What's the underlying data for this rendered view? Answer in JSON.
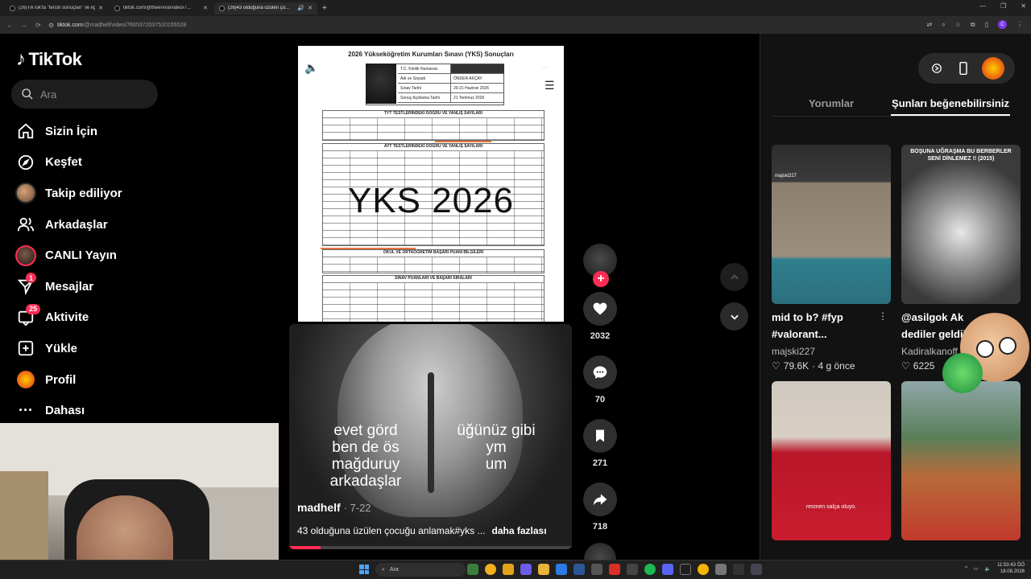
{
  "browser": {
    "tabs": [
      {
        "title": "(26)TikTok'ta \"tercih sonuçları\" ile ilgili...",
        "active": false
      },
      {
        "title": "tiktok.com/@theervva/video/7...",
        "active": false
      },
      {
        "title": "(26)43 olduğuna üzülen ço...",
        "active": true
      }
    ],
    "url_host": "tiktok.com",
    "url_path": "/@madhelf/video/7665372037510155528",
    "profile_initial": "C"
  },
  "sidebar": {
    "logo": "TikTok",
    "search_placeholder": "Ara",
    "items": [
      {
        "label": "Sizin İçin",
        "icon": "home-icon"
      },
      {
        "label": "Keşfet",
        "icon": "compass-icon"
      },
      {
        "label": "Takip ediliyor",
        "icon": "avatar"
      },
      {
        "label": "Arkadaşlar",
        "icon": "friends-icon"
      },
      {
        "label": "CANLI Yayın",
        "icon": "live-avatar"
      },
      {
        "label": "Mesajlar",
        "icon": "send-icon",
        "badge": "1"
      },
      {
        "label": "Aktivite",
        "icon": "inbox-icon",
        "badge": "25"
      },
      {
        "label": "Yükle",
        "icon": "plus-square-icon"
      },
      {
        "label": "Profil",
        "icon": "profile-avatar"
      },
      {
        "label": "Dahası",
        "icon": "more-icon"
      }
    ]
  },
  "video": {
    "doc_title": "2026 Yükseköğretim Kurumları Sınavı (YKS) Sonuçları",
    "id_rows": [
      {
        "k": "T.C. Kimlik Numarası",
        "v": ""
      },
      {
        "k": "Adı ve Soyadı",
        "v": "ÖNDER AKÇAY"
      },
      {
        "k": "Sınav Tarihi",
        "v": "20-21 Haziran 2026"
      },
      {
        "k": "Sonuç Açıklama Tarihi",
        "v": "21 Temmuz 2026"
      }
    ],
    "section_tyt": "TYT TESTLERİNDEKİ DOĞRU VE YANLIŞ SAYILARI",
    "section_ayt": "AYT TESTLERİNDEKİ DOĞRU VE YANLIŞ SAYILARI",
    "section_obp": "OKUL VE ORTAÖĞRETİM BAŞARI PUANI BİLGİLERİ",
    "section_puan": "SINAV PUANLARI VE BAŞARI SIRALARI",
    "overlay_title": "YKS 2026",
    "caption_left": "evet görd\nben de ös\nmağduruy\narkadaşlar",
    "caption_right": "üğünüz gibi\nym\num",
    "author": "madhelf",
    "date": "· 7-22",
    "description": "43 olduğuna üzülen çocuğu anlamak#yks ...",
    "more": "daha fazlası",
    "progress": 0.11
  },
  "actions": {
    "likes": "2032",
    "comments": "70",
    "saves": "271",
    "shares": "718"
  },
  "right_panel": {
    "tabs": [
      "Yorumlar",
      "Şunları beğenebilirsiniz"
    ],
    "active_tab": 1,
    "cards": [
      {
        "title": "mid to b? #fyp\n#valorant...",
        "author": "majski227",
        "likes": "79.6K",
        "age": "· 4 g önce",
        "thumb_tag": "majski227"
      },
      {
        "title": "@asilgok Ak\ndediler geldik",
        "author": "Kadiralkanoff",
        "likes": "6225",
        "age": "",
        "banner": "BOŞUNA UĞRAŞMA BU BERBERLER\nSENİ DİNLEMEZ !! (2015)"
      },
      {
        "title": "",
        "author": "",
        "likes": "",
        "age": "",
        "sub": "resmen salça oluyo."
      },
      {
        "title": "",
        "author": "",
        "likes": "",
        "age": ""
      }
    ]
  },
  "taskbar": {
    "search_placeholder": "Ara",
    "time": "11:53:43 ÖÖ",
    "date": "18.08.2026"
  }
}
